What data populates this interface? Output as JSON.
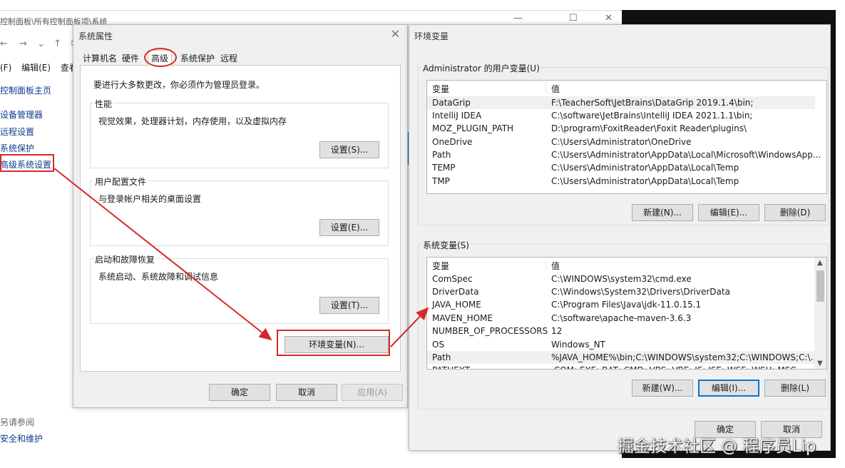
{
  "control_panel": {
    "title": "控制面板\\所有控制面板项\\系统",
    "nav_search_hint": "※",
    "menu": [
      "(F)",
      "编辑(E)",
      "查看"
    ],
    "links": [
      "控制面板主页",
      "设备管理器",
      "远程设置",
      "系统保护",
      "高级系统设置"
    ],
    "see_also": "另请参阅",
    "security": "安全和维护"
  },
  "system_properties": {
    "title": "系统属性",
    "tabs": [
      "计算机名",
      "硬件",
      "高级",
      "系统保护",
      "远程"
    ],
    "admin_note": "要进行大多数更改，你必须作为管理员登录。",
    "performance": {
      "title": "性能",
      "desc": "视觉效果，处理器计划，内存使用，以及虚拟内存",
      "button": "设置(S)..."
    },
    "user_profile": {
      "title": "用户配置文件",
      "desc": "与登录帐户相关的桌面设置",
      "button": "设置(E)..."
    },
    "startup": {
      "title": "启动和故障恢复",
      "desc": "系统启动、系统故障和调试信息",
      "button": "设置(T)..."
    },
    "env_button": "环境变量(N)...",
    "ok": "确定",
    "cancel": "取消",
    "apply": "应用(A)"
  },
  "environment_variables": {
    "title": "环境变量",
    "user_section": "Administrator 的用户变量(U)",
    "col_var": "变量",
    "col_val": "值",
    "user_vars": [
      {
        "name": "DataGrip",
        "value": "F:\\TeacherSoft\\JetBrains\\DataGrip 2019.1.4\\bin;"
      },
      {
        "name": "IntelliJ IDEA",
        "value": "C:\\software\\JetBrains\\IntelliJ IDEA 2021.1.1\\bin;"
      },
      {
        "name": "MOZ_PLUGIN_PATH",
        "value": "D:\\program\\FoxitReader\\Foxit Reader\\plugins\\"
      },
      {
        "name": "OneDrive",
        "value": "C:\\Users\\Administrator\\OneDrive"
      },
      {
        "name": "Path",
        "value": "C:\\Users\\Administrator\\AppData\\Local\\Microsoft\\WindowsApp..."
      },
      {
        "name": "TEMP",
        "value": "C:\\Users\\Administrator\\AppData\\Local\\Temp"
      },
      {
        "name": "TMP",
        "value": "C:\\Users\\Administrator\\AppData\\Local\\Temp"
      }
    ],
    "user_buttons": {
      "new": "新建(N)...",
      "edit": "编辑(E)...",
      "delete": "删除(D)"
    },
    "system_section": "系统变量(S)",
    "system_vars": [
      {
        "name": "ComSpec",
        "value": "C:\\WINDOWS\\system32\\cmd.exe"
      },
      {
        "name": "DriverData",
        "value": "C:\\Windows\\System32\\Drivers\\DriverData"
      },
      {
        "name": "JAVA_HOME",
        "value": "C:\\Program Files\\Java\\jdk-11.0.15.1"
      },
      {
        "name": "MAVEN_HOME",
        "value": "C:\\software\\apache-maven-3.6.3"
      },
      {
        "name": "NUMBER_OF_PROCESSORS",
        "value": "12"
      },
      {
        "name": "OS",
        "value": "Windows_NT"
      },
      {
        "name": "Path",
        "value": "%JAVA_HOME%\\bin;C:\\WINDOWS\\system32;C:\\WINDOWS;C:\\..."
      },
      {
        "name": "PATHEXT",
        "value": ".COM;.EXE;.BAT;.CMD;.VBS;.VBE;.JS;.JSE;.WSF;.WSH;.MSC"
      }
    ],
    "system_buttons": {
      "new": "新建(W)...",
      "edit": "编辑(I)...",
      "delete": "删除(L)"
    },
    "ok": "确定",
    "cancel": "取消"
  },
  "watermark": "掘金技术社区 @ 程序员Lip",
  "colors": {
    "annotation": "#d42a2a",
    "link": "#0b3c8c",
    "focus": "#0078d7"
  }
}
